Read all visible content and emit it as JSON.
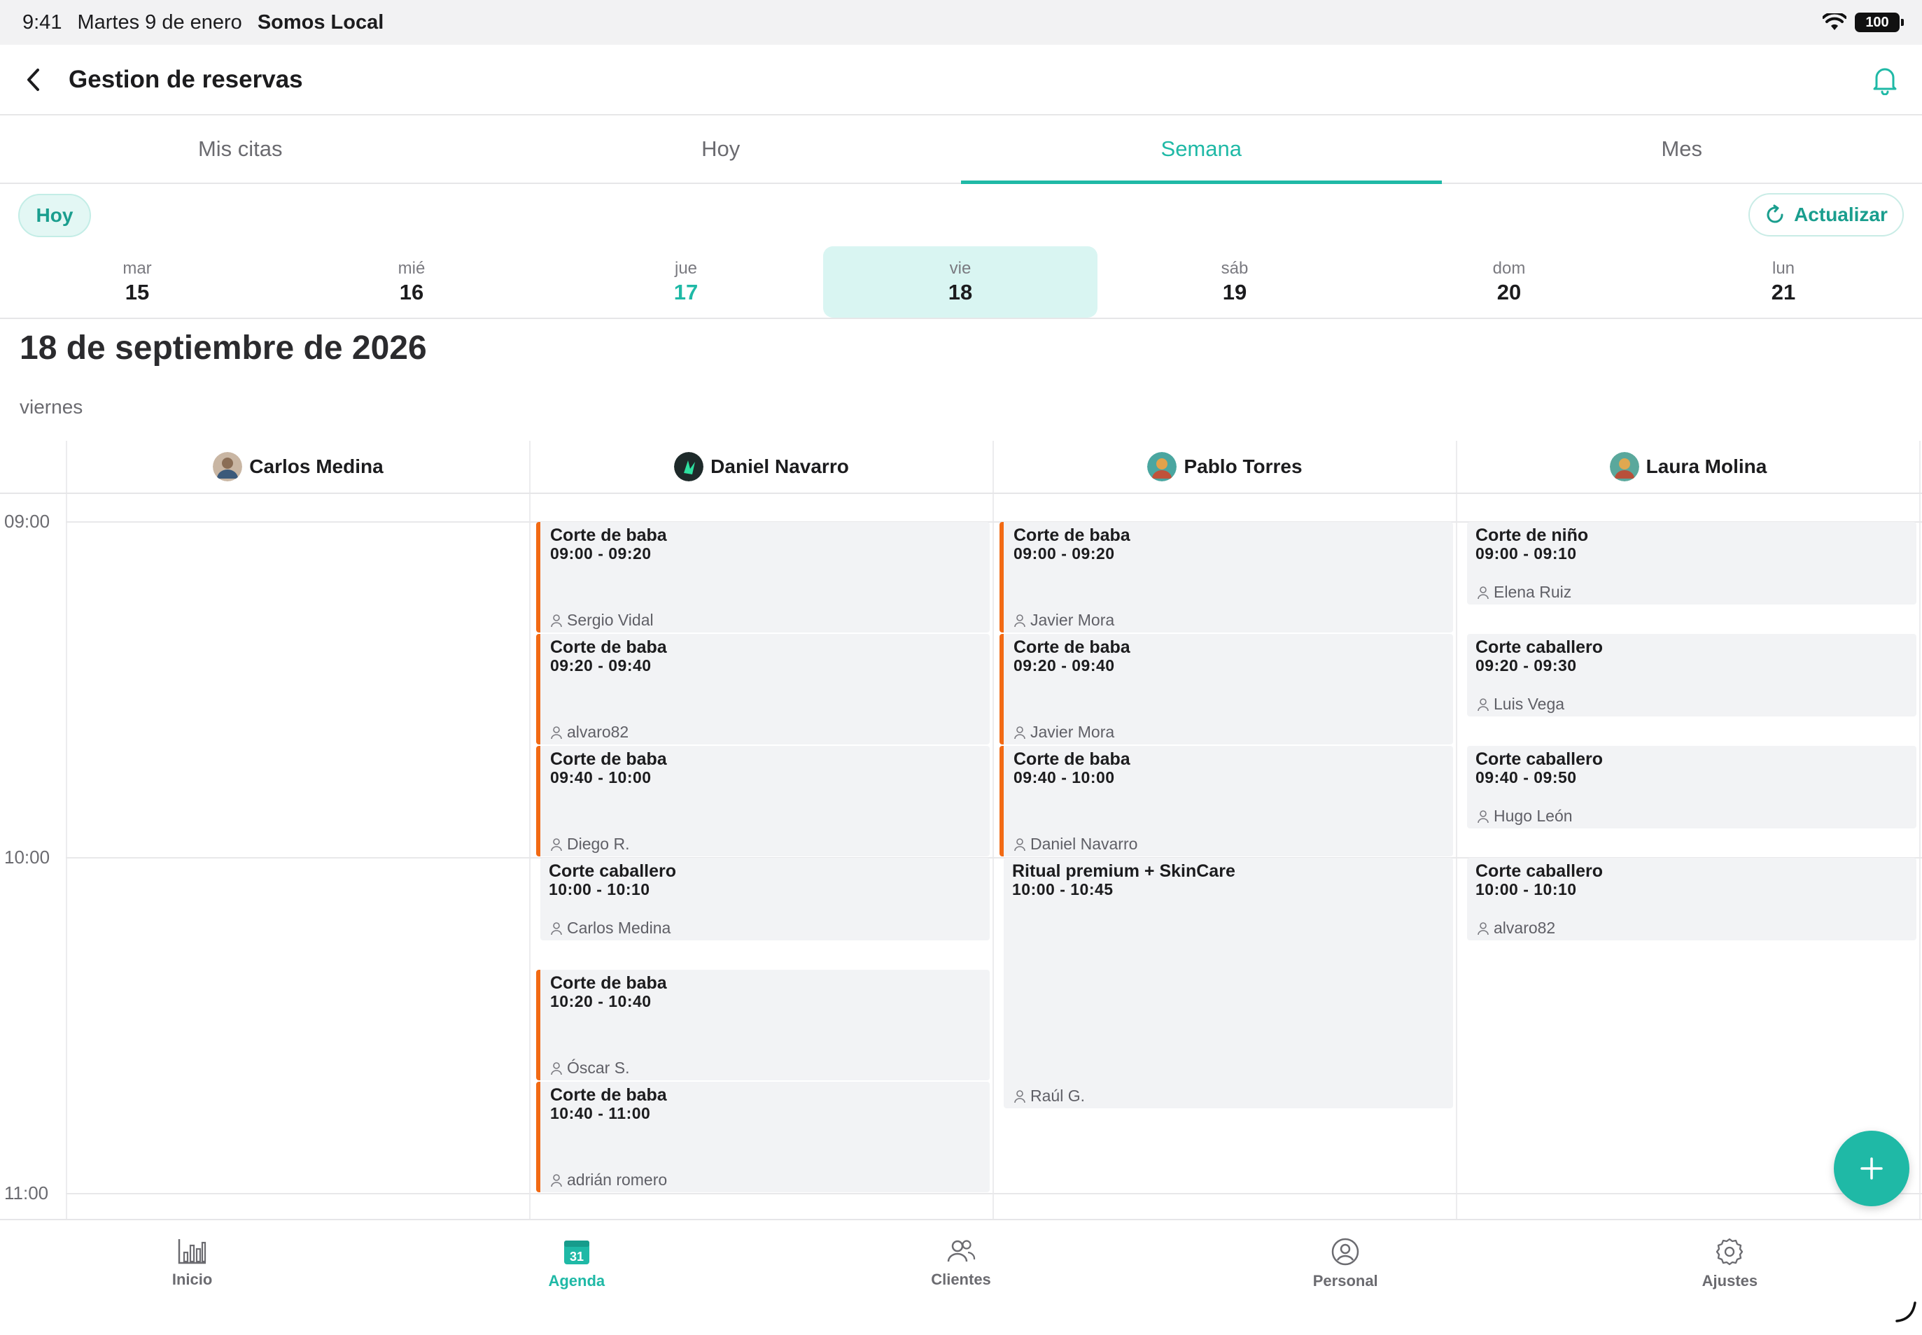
{
  "status_bar": {
    "time": "9:41",
    "date": "Martes 9 de enero",
    "carrier": "Somos Local",
    "battery": "100"
  },
  "header": {
    "title": "Gestion de reservas"
  },
  "tabs": [
    {
      "label": "Mis citas"
    },
    {
      "label": "Hoy"
    },
    {
      "label": "Semana"
    },
    {
      "label": "Mes"
    }
  ],
  "toolbar": {
    "today_label": "Hoy",
    "refresh_label": "Actualizar"
  },
  "week": [
    {
      "name": "mar",
      "num": "15"
    },
    {
      "name": "mié",
      "num": "16"
    },
    {
      "name": "jue",
      "num": "17"
    },
    {
      "name": "vie",
      "num": "18"
    },
    {
      "name": "sáb",
      "num": "19"
    },
    {
      "name": "dom",
      "num": "20"
    },
    {
      "name": "lun",
      "num": "21"
    }
  ],
  "selected_date": {
    "title": "18 de septiembre de 2026",
    "weekday": "viernes"
  },
  "hours": [
    "09:00",
    "10:00",
    "11:00"
  ],
  "staff": [
    {
      "name": "Carlos Medina"
    },
    {
      "name": "Daniel Navarro"
    },
    {
      "name": "Pablo Torres"
    },
    {
      "name": "Laura Molina"
    }
  ],
  "appointments": {
    "daniel": [
      {
        "service": "Corte de baba",
        "time": "09:00 - 09:20",
        "client": "Sergio Vidal"
      },
      {
        "service": "Corte de baba",
        "time": "09:20 - 09:40",
        "client": "alvaro82"
      },
      {
        "service": "Corte de baba",
        "time": "09:40 - 10:00",
        "client": "Diego R."
      },
      {
        "service": "Corte caballero",
        "time": "10:00 - 10:10",
        "client": "Carlos Medina"
      },
      {
        "service": "Corte de baba",
        "time": "10:20 - 10:40",
        "client": "Óscar S."
      },
      {
        "service": "Corte de baba",
        "time": "10:40 - 11:00",
        "client": "adrián romero"
      }
    ],
    "pablo": [
      {
        "service": "Corte de baba",
        "time": "09:00 - 09:20",
        "client": "Javier Mora"
      },
      {
        "service": "Corte de baba",
        "time": "09:20 - 09:40",
        "client": "Javier Mora"
      },
      {
        "service": "Corte de baba",
        "time": "09:40 - 10:00",
        "client": "Daniel Navarro"
      },
      {
        "service": "Ritual premium + SkinCare",
        "time": "10:00 - 10:45",
        "client": "Raúl G."
      }
    ],
    "laura": [
      {
        "service": "Corte de niño",
        "time": "09:00 - 09:10",
        "client": "Elena Ruiz"
      },
      {
        "service": "Corte caballero",
        "time": "09:20 - 09:30",
        "client": "Luis Vega"
      },
      {
        "service": "Corte caballero",
        "time": "09:40 - 09:50",
        "client": "Hugo León"
      },
      {
        "service": "Corte caballero",
        "time": "10:00 - 10:10",
        "client": "alvaro82"
      }
    ]
  },
  "bottom_nav": [
    {
      "label": "Inicio",
      "icon": "bar-chart-icon"
    },
    {
      "label": "Agenda",
      "icon": "calendar-icon",
      "badge": "31"
    },
    {
      "label": "Clientes",
      "icon": "users-icon"
    },
    {
      "label": "Personal",
      "icon": "user-circle-icon"
    },
    {
      "label": "Ajustes",
      "icon": "gear-icon"
    }
  ],
  "colors": {
    "accent": "#1fb9a6",
    "orange": "#f26a14",
    "card": "#f2f3f5"
  }
}
